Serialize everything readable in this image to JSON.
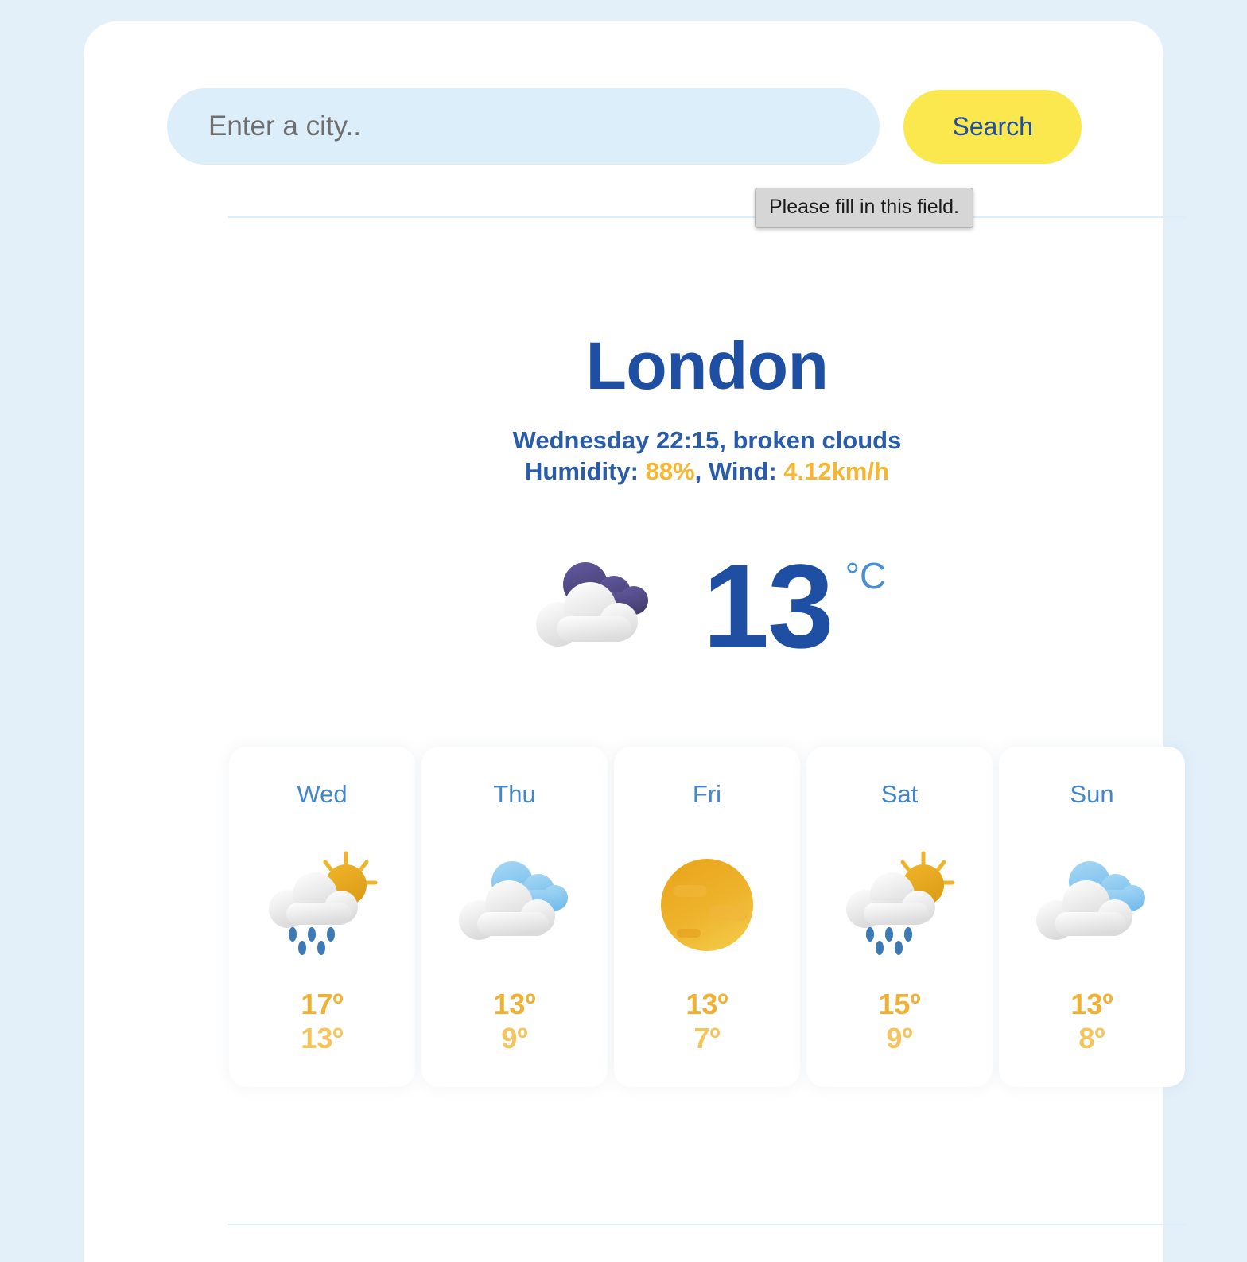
{
  "search": {
    "placeholder": "Enter a city..",
    "value": "",
    "button_label": "Search"
  },
  "validation": {
    "message": "Please fill in this field."
  },
  "current": {
    "city": "London",
    "datetime_description": "Wednesday 22:15, broken clouds",
    "humidity_label": "Humidity: ",
    "humidity_value": "88%",
    "wind_label": ", Wind: ",
    "wind_value": "4.12km/h",
    "temperature": "13",
    "unit": "°C",
    "icon": "broken-clouds-icon"
  },
  "forecast": [
    {
      "day": "Wed",
      "icon": "sun-rain-cloud-icon",
      "high": "17º",
      "low": "13º"
    },
    {
      "day": "Thu",
      "icon": "blue-cloud-icon",
      "high": "13º",
      "low": "9º"
    },
    {
      "day": "Fri",
      "icon": "sun-icon",
      "high": "13º",
      "low": "7º"
    },
    {
      "day": "Sat",
      "icon": "sun-rain-cloud-icon",
      "high": "15º",
      "low": "9º"
    },
    {
      "day": "Sun",
      "icon": "blue-cloud-icon",
      "high": "13º",
      "low": "8º"
    }
  ],
  "colors": {
    "page_background": "#e3f0fa",
    "card_background": "#ffffff",
    "primary_blue": "#1f4fa3",
    "accent_yellow": "#fbe84f",
    "temp_amber": "#efb034",
    "day_blue": "#4285cb",
    "input_blue": "#ddeefb"
  }
}
